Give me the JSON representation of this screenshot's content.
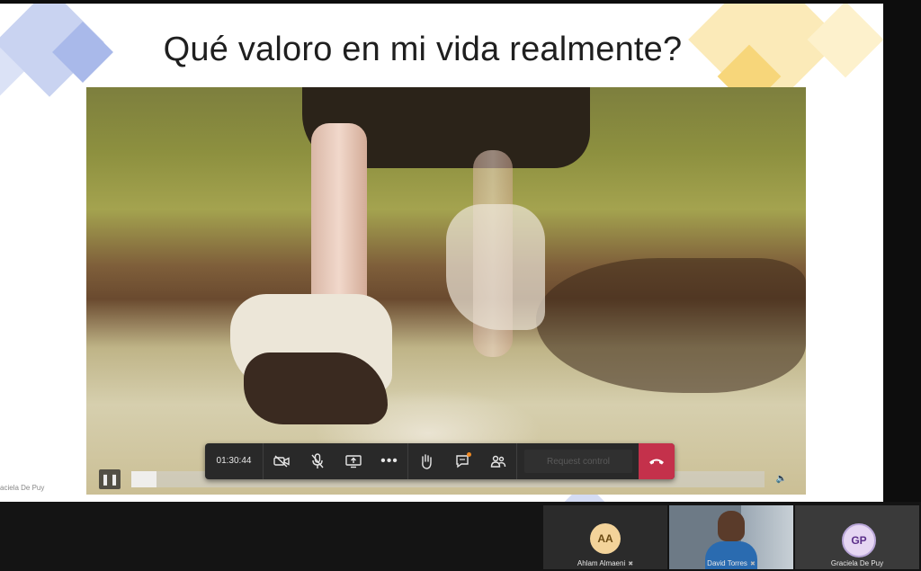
{
  "slide": {
    "title": "Qué valoro en mi vida realmente?",
    "presenter_tag": "aciela De Puy"
  },
  "video": {
    "progress": 0.04
  },
  "meeting_toolbar": {
    "timer": "01:30:44",
    "request_control_label": "Request control"
  },
  "participants": [
    {
      "initials": "AA",
      "name": "Ahlam Almaeni"
    },
    {
      "name": "David Torres"
    },
    {
      "initials": "GP",
      "name": "Graciela De Puy"
    }
  ],
  "colors": {
    "hangup": "#c4314b",
    "toolbar_bg": "#292929",
    "notification_dot": "#f08a24"
  },
  "icons": {
    "pause": "pause-icon",
    "volume": "volume-icon",
    "camera_off": "camera-off-icon",
    "mic_off": "mic-off-icon",
    "share": "share-screen-icon",
    "more": "more-icon",
    "raise_hand": "raise-hand-icon",
    "chat": "chat-icon",
    "participants": "participants-icon",
    "hangup": "hangup-icon"
  }
}
